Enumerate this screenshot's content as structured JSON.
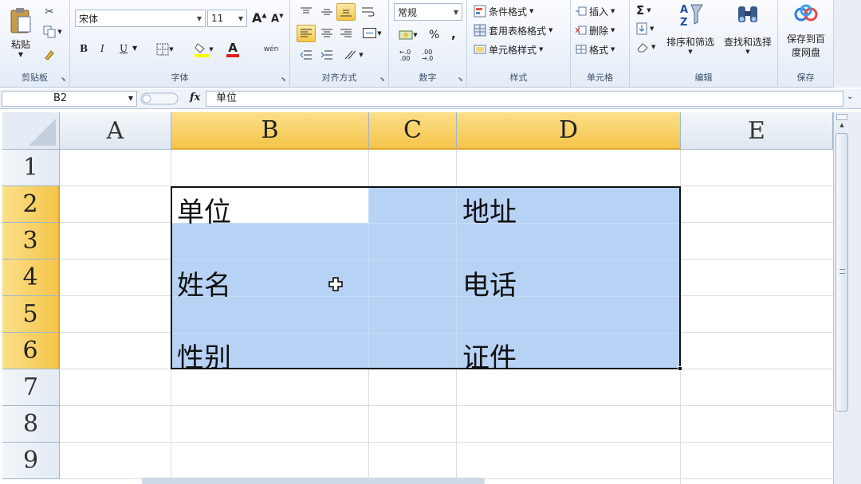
{
  "ribbon": {
    "clipboard": {
      "paste_label": "粘贴",
      "group_label": "剪贴板"
    },
    "font": {
      "font_name": "宋体",
      "font_size": "11",
      "group_label": "字体",
      "bold": "B",
      "italic": "I",
      "underline": "U",
      "wen": "wén",
      "font_color_glyph": "A"
    },
    "alignment": {
      "group_label": "对齐方式"
    },
    "number": {
      "format": "常规",
      "percent": "%",
      "comma": ",",
      "group_label": "数字"
    },
    "styles": {
      "conditional": "条件格式",
      "table_format": "套用表格格式",
      "cell_styles": "单元格样式",
      "group_label": "样式"
    },
    "cells": {
      "insert": "插入",
      "delete": "删除",
      "format": "格式",
      "group_label": "单元格"
    },
    "editing": {
      "sum_symbol": "Σ",
      "sort_filter": "排序和筛选",
      "find_select": "查找和选择",
      "group_label": "编辑"
    },
    "save": {
      "save_line1": "保存到百",
      "save_line2": "度网盘",
      "group_label": "保存"
    }
  },
  "formula_bar": {
    "name_box": "B2",
    "fx": "fx",
    "content": "单位"
  },
  "grid": {
    "columns": [
      "A",
      "B",
      "C",
      "D",
      "E"
    ],
    "rows": [
      "1",
      "2",
      "3",
      "4",
      "5",
      "6",
      "7",
      "8",
      "9"
    ],
    "selected_columns": [
      "B",
      "C",
      "D"
    ],
    "selected_rows": [
      "2",
      "3",
      "4",
      "5",
      "6"
    ],
    "selection_range": "B2:D6",
    "cells": {
      "B2": "单位",
      "D2": "地址",
      "B4": "姓名",
      "D4": "电话",
      "B6": "性别",
      "D6": "证件"
    }
  },
  "colors": {
    "selection": "#b7d2f5",
    "header_highlight": "#f5c44a",
    "ribbon_bg": "#e4ecf7"
  }
}
